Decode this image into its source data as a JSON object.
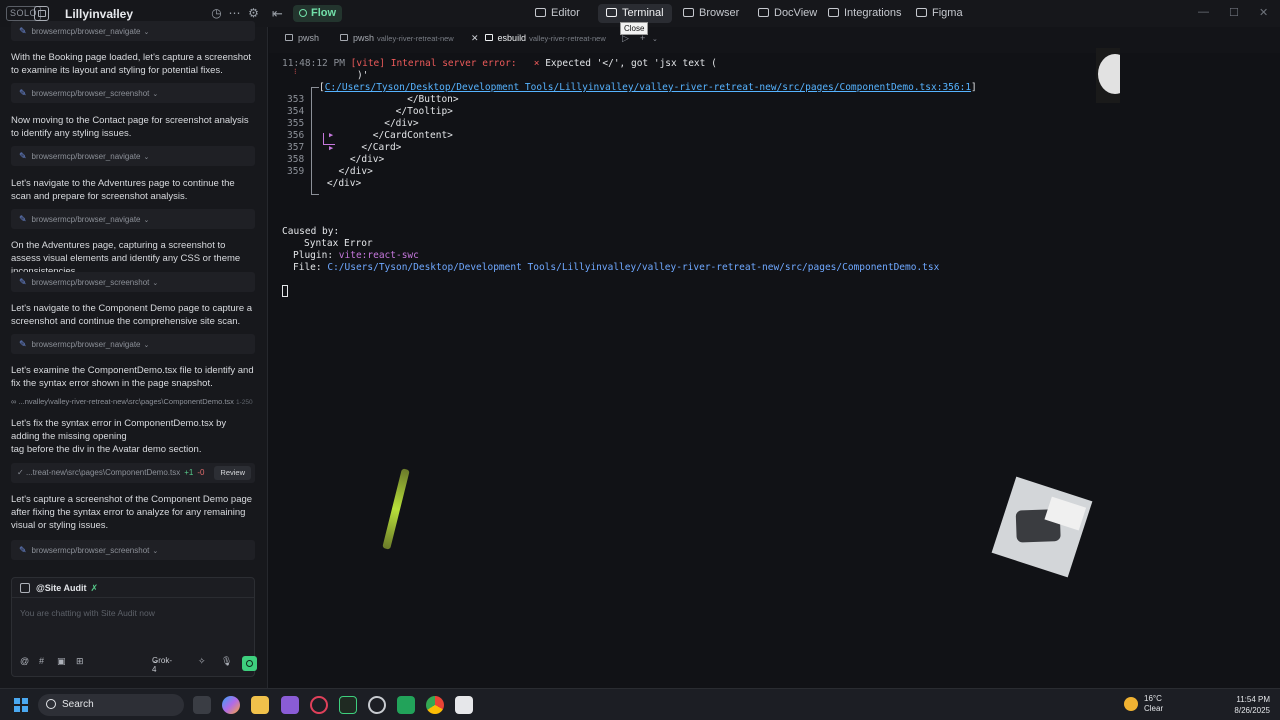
{
  "titlebar": {
    "solo_label": "SOLO",
    "workspace": "Lillyinvalley",
    "flow_label": "Flow",
    "nav": [
      "Editor",
      "Terminal",
      "Browser",
      "DocView",
      "Integrations",
      "Figma"
    ]
  },
  "sidebar": {
    "top_tool": "browsermcp/browser_navigate",
    "items": [
      {
        "type": "msg",
        "text": "With the Booking page loaded, let's capture a screenshot to examine its layout and styling for potential fixes."
      },
      {
        "type": "tool",
        "text": "browsermcp/browser_screenshot"
      },
      {
        "type": "msg",
        "text": "Now moving to the Contact page for screenshot analysis to identify any styling issues."
      },
      {
        "type": "tool",
        "text": "browsermcp/browser_navigate"
      },
      {
        "type": "msg",
        "text": "Let's navigate to the Adventures page to continue the scan and prepare for screenshot analysis."
      },
      {
        "type": "tool",
        "text": "browsermcp/browser_navigate"
      },
      {
        "type": "msg",
        "text": "On the Adventures page, capturing a screenshot to assess visual elements and identify any CSS or theme inconsistencies."
      },
      {
        "type": "tool",
        "text": "browsermcp/browser_screenshot"
      },
      {
        "type": "msg",
        "text": "Let's navigate to the Component Demo page to capture a screenshot and continue the comprehensive site scan."
      },
      {
        "type": "tool",
        "text": "browsermcp/browser_navigate"
      },
      {
        "type": "msg",
        "text": "Let's examine the ComponentDemo.tsx file to identify and fix the syntax error shown in the page snapshot."
      },
      {
        "type": "file",
        "text": "...nvalley\\valley-river-retreat-new\\src\\pages\\ComponentDemo.tsx",
        "range": "1-250"
      },
      {
        "type": "msg",
        "text": "Let's fix the syntax error in ComponentDemo.tsx by adding the missing opening\ntag before the div in the Avatar demo section."
      },
      {
        "type": "diff",
        "text": "...treat-new\\src\\pages\\ComponentDemo.tsx",
        "plus": "+1",
        "minus": "-0",
        "review": "Review"
      },
      {
        "type": "msg",
        "text": "Let's capture a screenshot of the Component Demo page after fixing the syntax error to analyze for any remaining visual or styling issues."
      },
      {
        "type": "tool",
        "text": "browsermcp/browser_screenshot"
      }
    ]
  },
  "chat": {
    "agent": "@Site Audit",
    "placeholder": "You are chatting with Site Audit now",
    "model": "Grok-4"
  },
  "tabs": {
    "items": [
      {
        "name": "pwsh",
        "sub": ""
      },
      {
        "name": "pwsh",
        "sub": "valley-river-retreat-new"
      },
      {
        "name": "esbuild",
        "sub": "valley-river-retreat-new"
      }
    ],
    "tooltip": "Close"
  },
  "terminal": {
    "time": "11:48:12 PM",
    "vite_tag": "[vite]",
    "error_label": "Internal server error:",
    "error_msg": "Expected '</', got 'jsx text (",
    "error_cont": ")'",
    "file_link": "C:/Users/Tyson/Desktop/Development Tools/Lillyinvalley/valley-river-retreat-new/src/pages/ComponentDemo.tsx:356:1",
    "code": [
      {
        "n": "353",
        "code": "                  </Button>"
      },
      {
        "n": "354",
        "code": "                </Tooltip>"
      },
      {
        "n": "355",
        "code": "              </div>"
      },
      {
        "n": "356",
        "code": "            </CardContent>"
      },
      {
        "n": "357",
        "code": "          </Card>"
      },
      {
        "n": "358",
        "code": "        </div>"
      },
      {
        "n": "359",
        "code": "      </div>"
      },
      {
        "n": "",
        "code": "    </div>"
      }
    ],
    "caused_by": "Caused by:",
    "syntax_error": "Syntax Error",
    "plugin_label": "Plugin:",
    "plugin_value": "vite:react-swc",
    "file_label": "File:",
    "file_value": "C:/Users/Tyson/Desktop/Development Tools/Lillyinvalley/valley-river-retreat-new/src/pages/ComponentDemo.tsx"
  },
  "taskbar": {
    "search": "Search",
    "temp": "16°C",
    "weather": "Clear",
    "time": "11:54 PM",
    "date": "8/26/2025"
  }
}
